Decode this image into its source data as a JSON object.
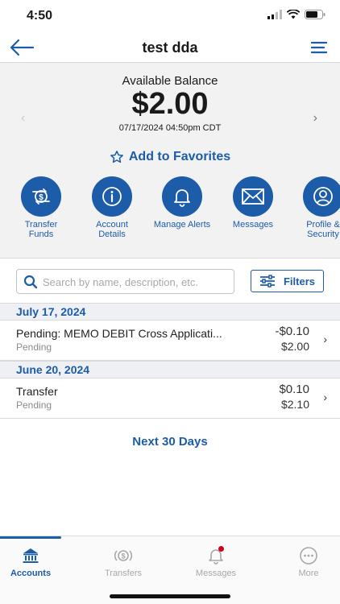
{
  "status_bar": {
    "time": "4:50"
  },
  "nav": {
    "title": "test dda"
  },
  "balance": {
    "label": "Available Balance",
    "amount": "$2.00",
    "as_of": "07/17/2024 04:50pm CDT"
  },
  "favorites_label": "Add to Favorites",
  "actions": [
    {
      "label": "Transfer Funds",
      "icon": "transfer-icon"
    },
    {
      "label": "Account Details",
      "icon": "info-icon"
    },
    {
      "label": "Manage Alerts",
      "icon": "bell-icon"
    },
    {
      "label": "Messages",
      "icon": "envelope-icon"
    },
    {
      "label": "Profile & Security",
      "icon": "profile-icon"
    }
  ],
  "search": {
    "placeholder": "Search by name, description, etc.",
    "value": ""
  },
  "filters_label": "Filters",
  "groups": [
    {
      "date": "July 17, 2024",
      "transactions": [
        {
          "description": "Pending: MEMO DEBIT Cross Applicati...",
          "status": "Pending",
          "amount": "-$0.10",
          "balance": "$2.00"
        }
      ]
    },
    {
      "date": "June 20, 2024",
      "transactions": [
        {
          "description": "Transfer",
          "status": "Pending",
          "amount": "$0.10",
          "balance": "$2.10"
        }
      ]
    }
  ],
  "next_label": "Next 30 Days",
  "tabs": [
    {
      "label": "Accounts",
      "icon": "bank-icon",
      "active": true
    },
    {
      "label": "Transfers",
      "icon": "transfer-icon",
      "active": false
    },
    {
      "label": "Messages",
      "icon": "bell-icon",
      "active": false,
      "badge": true
    },
    {
      "label": "More",
      "icon": "more-icon",
      "active": false
    }
  ],
  "colors": {
    "accent": "#1c5ca8",
    "badge": "#d0021b"
  }
}
